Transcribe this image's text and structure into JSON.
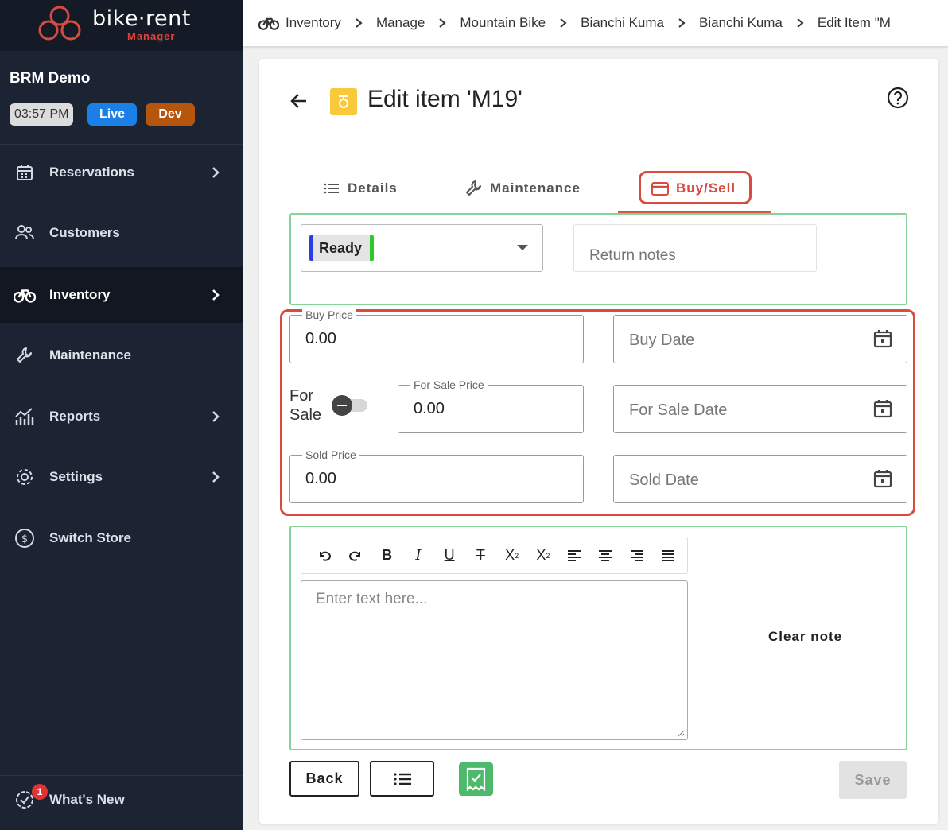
{
  "app": {
    "logo_text": "bike·rent",
    "logo_sub": "Manager",
    "store_name": "BRM Demo",
    "time": "03:57 PM",
    "live_badge": "Live",
    "dev_badge": "Dev"
  },
  "sidebar": {
    "items": [
      {
        "label": "Reservations",
        "icon": "calendar-icon",
        "chevron": true
      },
      {
        "label": "Customers",
        "icon": "users-icon",
        "chevron": false
      },
      {
        "label": "Inventory",
        "icon": "bike-icon",
        "chevron": true,
        "active": true
      },
      {
        "label": "Maintenance",
        "icon": "wrench-icon",
        "chevron": false
      },
      {
        "label": "Reports",
        "icon": "chart-icon",
        "chevron": true
      },
      {
        "label": "Settings",
        "icon": "gear-icon",
        "chevron": true
      },
      {
        "label": "Switch Store",
        "icon": "switch-icon",
        "chevron": false
      }
    ],
    "whats_new": "What's New",
    "notification_count": "1"
  },
  "breadcrumb": [
    "Inventory",
    "Manage",
    "Mountain Bike",
    "Bianchi Kuma",
    "Bianchi Kuma",
    "Edit Item \"M"
  ],
  "page": {
    "title": "Edit item 'M19'"
  },
  "tabs": [
    {
      "label": "Details",
      "icon": "list-icon"
    },
    {
      "label": "Maintenance",
      "icon": "wrench-icon"
    },
    {
      "label": "Buy/Sell",
      "icon": "card-icon",
      "active": true
    }
  ],
  "status": {
    "selected": "Ready"
  },
  "return_notes": {
    "placeholder": "Return notes"
  },
  "buy_sell": {
    "buy_price_label": "Buy Price",
    "buy_price_value": "0.00",
    "buy_date_placeholder": "Buy Date",
    "for_sale_label": "For\nSale",
    "for_sale_toggle": false,
    "for_sale_price_label": "For Sale Price",
    "for_sale_price_value": "0.00",
    "for_sale_date_placeholder": "For Sale Date",
    "sold_price_label": "Sold Price",
    "sold_price_value": "0.00",
    "sold_date_placeholder": "Sold Date"
  },
  "editor": {
    "toolbar": [
      "undo",
      "redo",
      "B",
      "I",
      "U",
      "strikethrough",
      "subscript",
      "superscript",
      "align-left",
      "align-center",
      "align-right",
      "justify"
    ],
    "placeholder": "Enter text here...",
    "clear_note": "Clear note"
  },
  "actions": {
    "back": "Back",
    "save": "Save"
  },
  "colors": {
    "sidebar_bg": "#1c2333",
    "accent_red": "#d94b3e",
    "green_border": "#86d29a",
    "live_blue": "#1a7fe6",
    "dev_orange": "#b5550e"
  }
}
